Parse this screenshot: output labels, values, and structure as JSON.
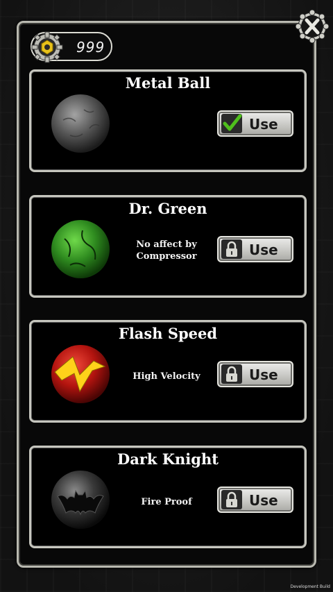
{
  "coins": {
    "value": "999",
    "icon": "gear-coin-icon"
  },
  "close": {
    "icon": "close-icon"
  },
  "balls": [
    {
      "title": "Metal Ball",
      "description": "",
      "button": "Use",
      "status_icon": "checkmark-icon",
      "colors": {
        "main": "#5a5a5a",
        "highlight": "#9a9a9a"
      }
    },
    {
      "title": "Dr. Green",
      "description": "No affect by Compressor",
      "button": "Use",
      "status_icon": "lock-icon",
      "colors": {
        "main": "#2e8a1f",
        "highlight": "#6fd94a"
      }
    },
    {
      "title": "Flash Speed",
      "description": "High Velocity",
      "button": "Use",
      "status_icon": "lock-icon",
      "colors": {
        "main": "#b3140f",
        "highlight": "#ffd21a"
      }
    },
    {
      "title": "Dark Knight",
      "description": "Fire Proof",
      "button": "Use",
      "status_icon": "lock-icon",
      "colors": {
        "main": "#2a2a2a",
        "highlight": "#111111"
      }
    }
  ],
  "footer": {
    "dev_build": "Development Build"
  }
}
